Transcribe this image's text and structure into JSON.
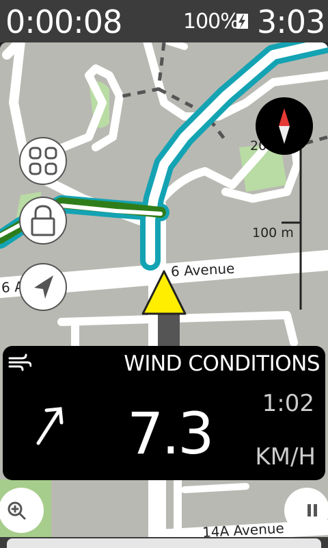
{
  "status": {
    "elapsed": "0:00:08",
    "battery": "100%",
    "clock": "3:03"
  },
  "map": {
    "scale_top": "200 m",
    "scale_bottom": "100 m",
    "streets": [
      "6 Avenue",
      "6 A",
      "14A Avenue"
    ]
  },
  "panel": {
    "title": "WIND CONDITIONS",
    "value": "7.3",
    "time": "1:02",
    "unit": "KM/H"
  },
  "colors": {
    "route": "#14a3b3",
    "route_green": "#2f7d1a",
    "park": "#b9dba4",
    "cursor": "#ffee00"
  },
  "icons": {
    "apps": "grid-icon",
    "lock": "lock-icon",
    "locate": "navigation-arrow-icon",
    "compass": "compass-icon",
    "zoom": "zoom-in-icon",
    "pause": "pause-icon",
    "wind": "wind-icon"
  }
}
